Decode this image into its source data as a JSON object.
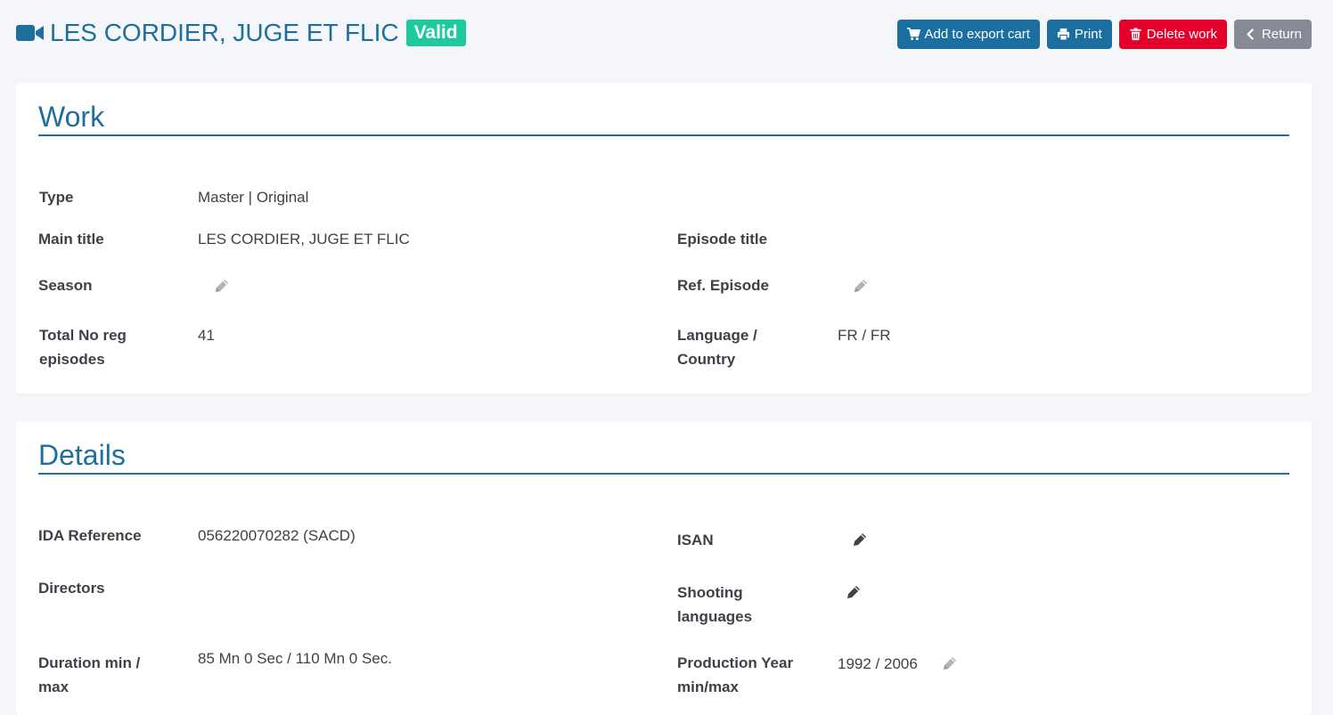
{
  "header": {
    "title": "LES CORDIER, JUGE ET FLIC",
    "status": "Valid",
    "actions": {
      "export": "Add to export cart",
      "print": "Print",
      "delete": "Delete work",
      "return": "Return"
    }
  },
  "work": {
    "heading": "Work",
    "type": {
      "label": "Type",
      "value": "Master | Original"
    },
    "main_title": {
      "label": "Main title",
      "value": "LES CORDIER, JUGE ET FLIC"
    },
    "episode_title": {
      "label": "Episode title",
      "value": ""
    },
    "season": {
      "label": "Season",
      "value": ""
    },
    "ref_episode": {
      "label": "Ref. Episode",
      "value": ""
    },
    "total_episodes": {
      "label_line1": "Total No reg",
      "label_line2": "episodes",
      "value": "41"
    },
    "language_country": {
      "label_line1": "Language /",
      "label_line2": "Country",
      "value": "FR / FR"
    }
  },
  "details": {
    "heading": "Details",
    "ida_reference": {
      "label": "IDA Reference",
      "value": "056220070282 (SACD)"
    },
    "isan": {
      "label": "ISAN",
      "value": ""
    },
    "directors": {
      "label": "Directors",
      "value": ""
    },
    "shooting_languages": {
      "label_line1": "Shooting",
      "label_line2": "languages",
      "value": ""
    },
    "duration": {
      "label_line1": "Duration min /",
      "label_line2": "max",
      "value": "85 Mn 0 Sec / 110 Mn 0 Sec."
    },
    "production_year": {
      "label_line1": "Production Year",
      "label_line2": "min/max",
      "value": "1992 / 2006"
    }
  },
  "colors": {
    "primary": "#1a6fa0",
    "title": "#1f6f9d",
    "valid": "#1ec99e",
    "danger": "#e4002b",
    "secondary": "#878a94"
  },
  "icons": {
    "title": "video-camera-icon",
    "export": "shopping-cart-icon",
    "print": "printer-icon",
    "delete": "trash-icon",
    "return": "chevron-left-icon",
    "edit": "pencil-icon"
  }
}
